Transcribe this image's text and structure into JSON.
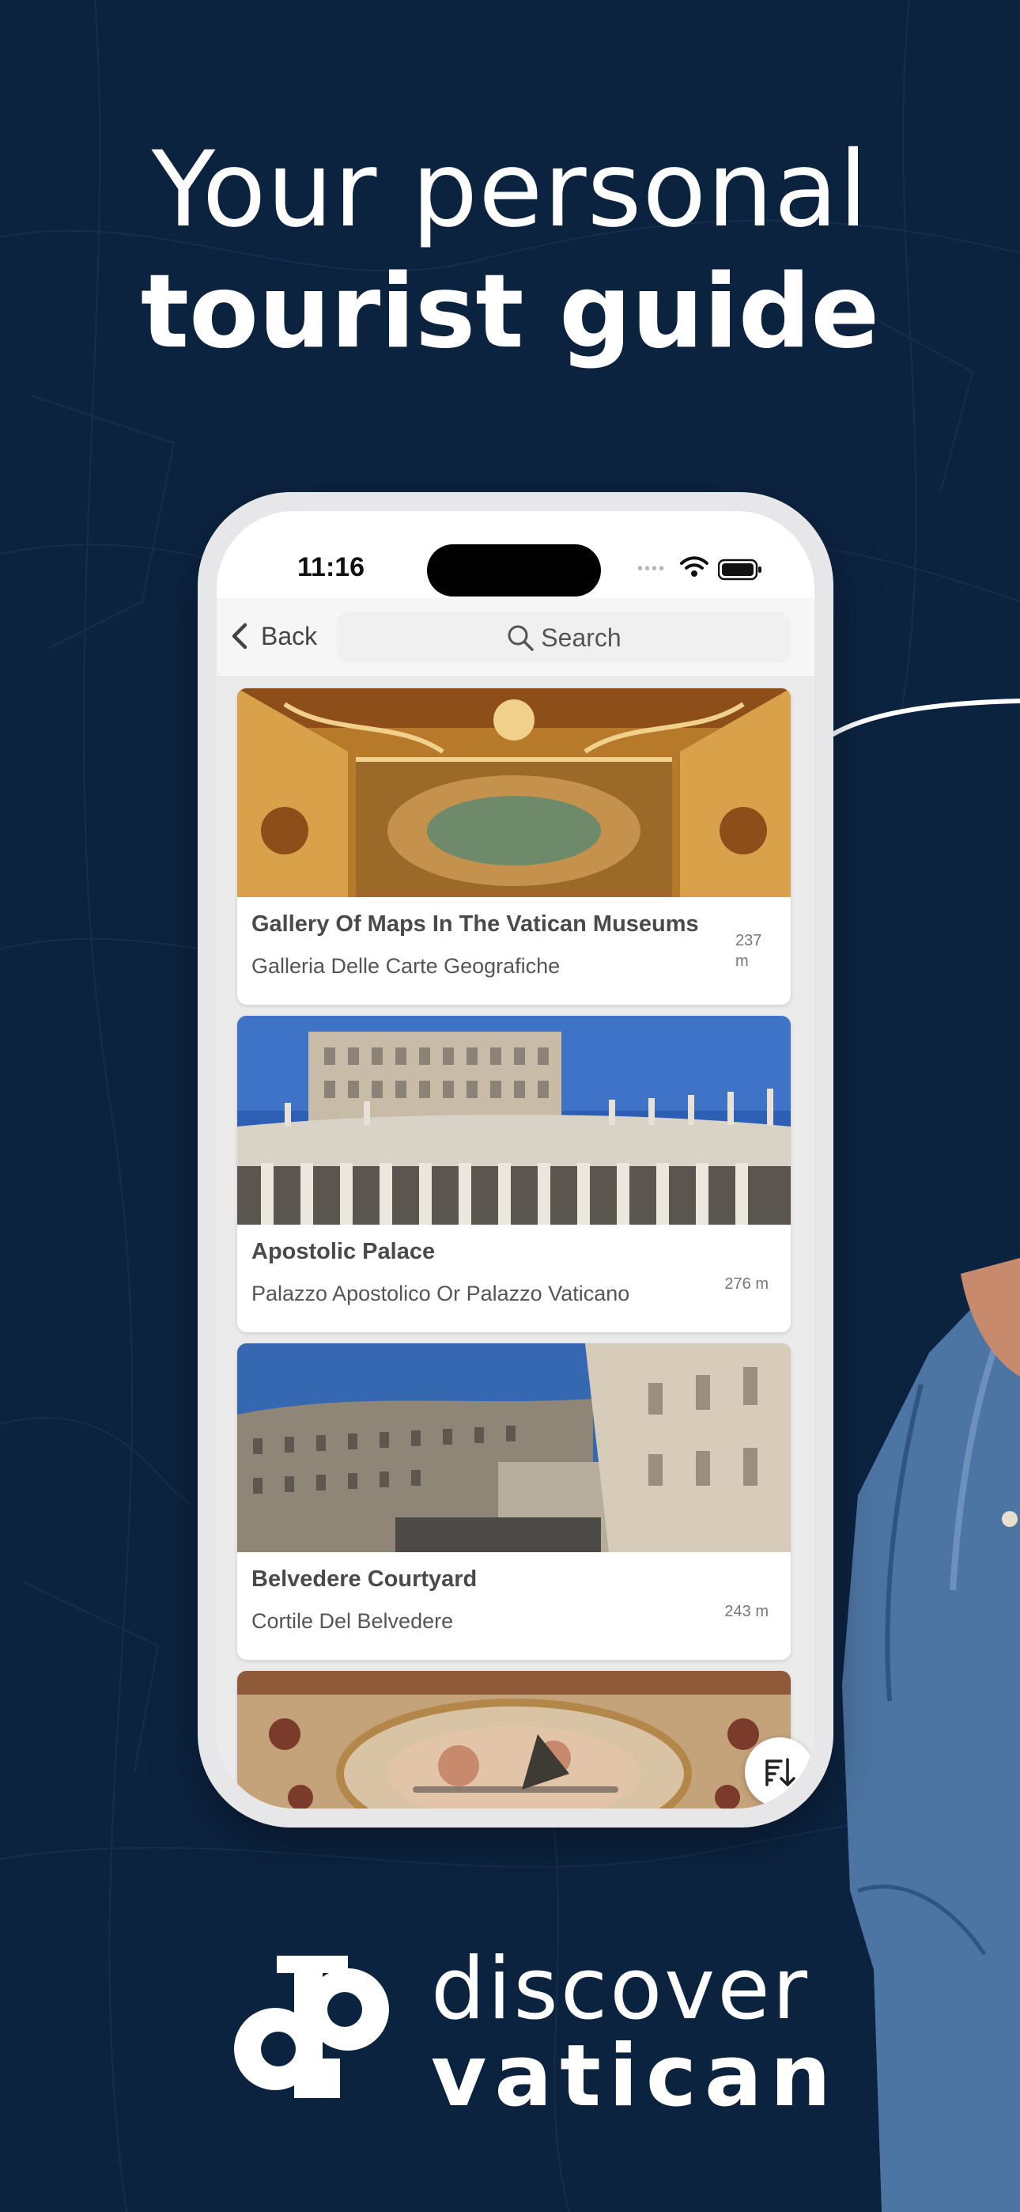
{
  "headline": {
    "line1": "Your personal",
    "line2": "tourist guide"
  },
  "status_bar": {
    "time": "11:16"
  },
  "nav": {
    "back_label": "Back",
    "search_placeholder": "Search"
  },
  "places": [
    {
      "title": "Gallery Of Maps In The Vatican Museums",
      "subtitle": "Galleria Delle Carte Geografiche",
      "distance": "237 m"
    },
    {
      "title": "Apostolic Palace",
      "subtitle": "Palazzo Apostolico Or Palazzo Vaticano",
      "distance": "276 m"
    },
    {
      "title": "Belvedere Courtyard",
      "subtitle": "Cortile Del Belvedere",
      "distance": "243 m"
    },
    {
      "title": "",
      "subtitle": "",
      "distance": ""
    }
  ],
  "brand": {
    "line1": "discover",
    "line2": "vatican",
    "logo_letters": "dp"
  },
  "icons": {
    "back": "chevron-left-icon",
    "search": "search-icon",
    "sort": "sort-descending-icon",
    "wifi": "wifi-icon",
    "battery": "battery-icon"
  },
  "colors": {
    "background": "#0c2340",
    "card": "#ffffff",
    "list_bg": "#ebebeb"
  }
}
